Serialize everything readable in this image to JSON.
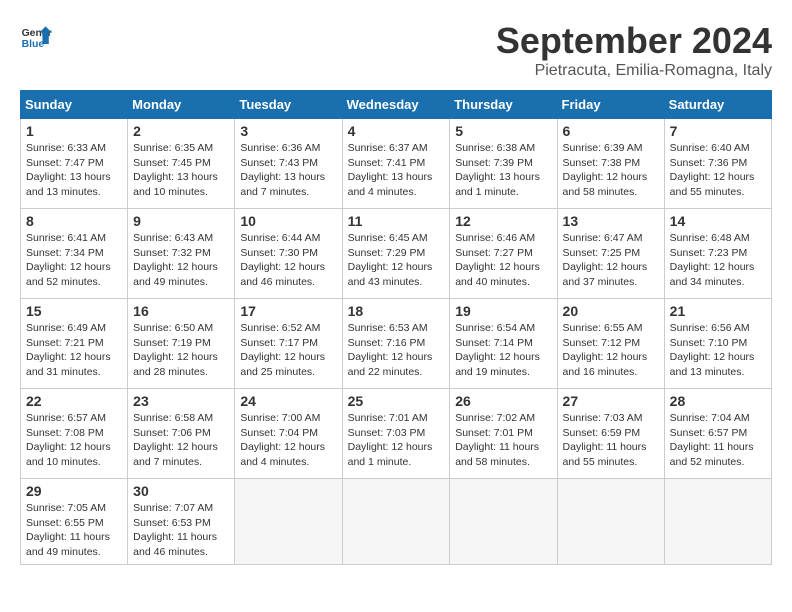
{
  "logo": {
    "text_general": "General",
    "text_blue": "Blue"
  },
  "header": {
    "title": "September 2024",
    "subtitle": "Pietracuta, Emilia-Romagna, Italy"
  },
  "days_of_week": [
    "Sunday",
    "Monday",
    "Tuesday",
    "Wednesday",
    "Thursday",
    "Friday",
    "Saturday"
  ],
  "weeks": [
    [
      {
        "day": "1",
        "info": "Sunrise: 6:33 AM\nSunset: 7:47 PM\nDaylight: 13 hours\nand 13 minutes."
      },
      {
        "day": "2",
        "info": "Sunrise: 6:35 AM\nSunset: 7:45 PM\nDaylight: 13 hours\nand 10 minutes."
      },
      {
        "day": "3",
        "info": "Sunrise: 6:36 AM\nSunset: 7:43 PM\nDaylight: 13 hours\nand 7 minutes."
      },
      {
        "day": "4",
        "info": "Sunrise: 6:37 AM\nSunset: 7:41 PM\nDaylight: 13 hours\nand 4 minutes."
      },
      {
        "day": "5",
        "info": "Sunrise: 6:38 AM\nSunset: 7:39 PM\nDaylight: 13 hours\nand 1 minute."
      },
      {
        "day": "6",
        "info": "Sunrise: 6:39 AM\nSunset: 7:38 PM\nDaylight: 12 hours\nand 58 minutes."
      },
      {
        "day": "7",
        "info": "Sunrise: 6:40 AM\nSunset: 7:36 PM\nDaylight: 12 hours\nand 55 minutes."
      }
    ],
    [
      {
        "day": "8",
        "info": "Sunrise: 6:41 AM\nSunset: 7:34 PM\nDaylight: 12 hours\nand 52 minutes."
      },
      {
        "day": "9",
        "info": "Sunrise: 6:43 AM\nSunset: 7:32 PM\nDaylight: 12 hours\nand 49 minutes."
      },
      {
        "day": "10",
        "info": "Sunrise: 6:44 AM\nSunset: 7:30 PM\nDaylight: 12 hours\nand 46 minutes."
      },
      {
        "day": "11",
        "info": "Sunrise: 6:45 AM\nSunset: 7:29 PM\nDaylight: 12 hours\nand 43 minutes."
      },
      {
        "day": "12",
        "info": "Sunrise: 6:46 AM\nSunset: 7:27 PM\nDaylight: 12 hours\nand 40 minutes."
      },
      {
        "day": "13",
        "info": "Sunrise: 6:47 AM\nSunset: 7:25 PM\nDaylight: 12 hours\nand 37 minutes."
      },
      {
        "day": "14",
        "info": "Sunrise: 6:48 AM\nSunset: 7:23 PM\nDaylight: 12 hours\nand 34 minutes."
      }
    ],
    [
      {
        "day": "15",
        "info": "Sunrise: 6:49 AM\nSunset: 7:21 PM\nDaylight: 12 hours\nand 31 minutes."
      },
      {
        "day": "16",
        "info": "Sunrise: 6:50 AM\nSunset: 7:19 PM\nDaylight: 12 hours\nand 28 minutes."
      },
      {
        "day": "17",
        "info": "Sunrise: 6:52 AM\nSunset: 7:17 PM\nDaylight: 12 hours\nand 25 minutes."
      },
      {
        "day": "18",
        "info": "Sunrise: 6:53 AM\nSunset: 7:16 PM\nDaylight: 12 hours\nand 22 minutes."
      },
      {
        "day": "19",
        "info": "Sunrise: 6:54 AM\nSunset: 7:14 PM\nDaylight: 12 hours\nand 19 minutes."
      },
      {
        "day": "20",
        "info": "Sunrise: 6:55 AM\nSunset: 7:12 PM\nDaylight: 12 hours\nand 16 minutes."
      },
      {
        "day": "21",
        "info": "Sunrise: 6:56 AM\nSunset: 7:10 PM\nDaylight: 12 hours\nand 13 minutes."
      }
    ],
    [
      {
        "day": "22",
        "info": "Sunrise: 6:57 AM\nSunset: 7:08 PM\nDaylight: 12 hours\nand 10 minutes."
      },
      {
        "day": "23",
        "info": "Sunrise: 6:58 AM\nSunset: 7:06 PM\nDaylight: 12 hours\nand 7 minutes."
      },
      {
        "day": "24",
        "info": "Sunrise: 7:00 AM\nSunset: 7:04 PM\nDaylight: 12 hours\nand 4 minutes."
      },
      {
        "day": "25",
        "info": "Sunrise: 7:01 AM\nSunset: 7:03 PM\nDaylight: 12 hours\nand 1 minute."
      },
      {
        "day": "26",
        "info": "Sunrise: 7:02 AM\nSunset: 7:01 PM\nDaylight: 11 hours\nand 58 minutes."
      },
      {
        "day": "27",
        "info": "Sunrise: 7:03 AM\nSunset: 6:59 PM\nDaylight: 11 hours\nand 55 minutes."
      },
      {
        "day": "28",
        "info": "Sunrise: 7:04 AM\nSunset: 6:57 PM\nDaylight: 11 hours\nand 52 minutes."
      }
    ],
    [
      {
        "day": "29",
        "info": "Sunrise: 7:05 AM\nSunset: 6:55 PM\nDaylight: 11 hours\nand 49 minutes."
      },
      {
        "day": "30",
        "info": "Sunrise: 7:07 AM\nSunset: 6:53 PM\nDaylight: 11 hours\nand 46 minutes."
      },
      {
        "day": "",
        "info": ""
      },
      {
        "day": "",
        "info": ""
      },
      {
        "day": "",
        "info": ""
      },
      {
        "day": "",
        "info": ""
      },
      {
        "day": "",
        "info": ""
      }
    ]
  ]
}
